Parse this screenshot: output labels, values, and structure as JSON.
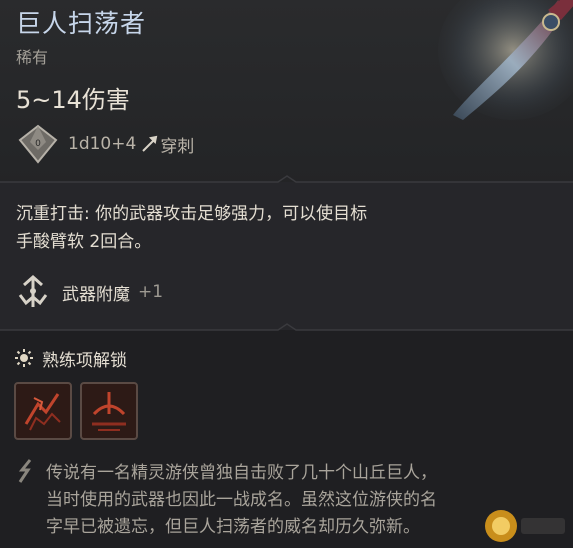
{
  "item": {
    "name": "巨人扫荡者",
    "rarity": "稀有",
    "damage": "5~14伤害",
    "dice": "1d10+4",
    "damage_type": "穿刺"
  },
  "passive": {
    "text_line1": "沉重打击: 你的武器攻击足够强力，可以使目标",
    "text_line2": "手酸臂软 2回合。"
  },
  "enchant": {
    "label": "武器附魔",
    "value": "+1"
  },
  "proficiency": {
    "label": "熟练项解锁"
  },
  "lore": {
    "line1": "传说有一名精灵游侠曾独自击败了几十个山丘巨人，",
    "line2": "当时使用的武器也因此一战成名。虽然这位游侠的名",
    "line3": "字早已被遗忘，但巨人扫荡者的威名却历久弥新。"
  },
  "colors": {
    "title": "#c7d6ea",
    "accent_red": "#c0442c",
    "panel": "#26262a"
  },
  "icons": {
    "dice": "d10-dice-icon",
    "damage_type": "piercing-icon",
    "enchant": "weapon-enchant-icon",
    "proficiency": "proficiency-unlock-icon",
    "action1": "weapon-action-icon",
    "action2": "weapon-action-icon",
    "lore": "lore-feather-icon"
  }
}
